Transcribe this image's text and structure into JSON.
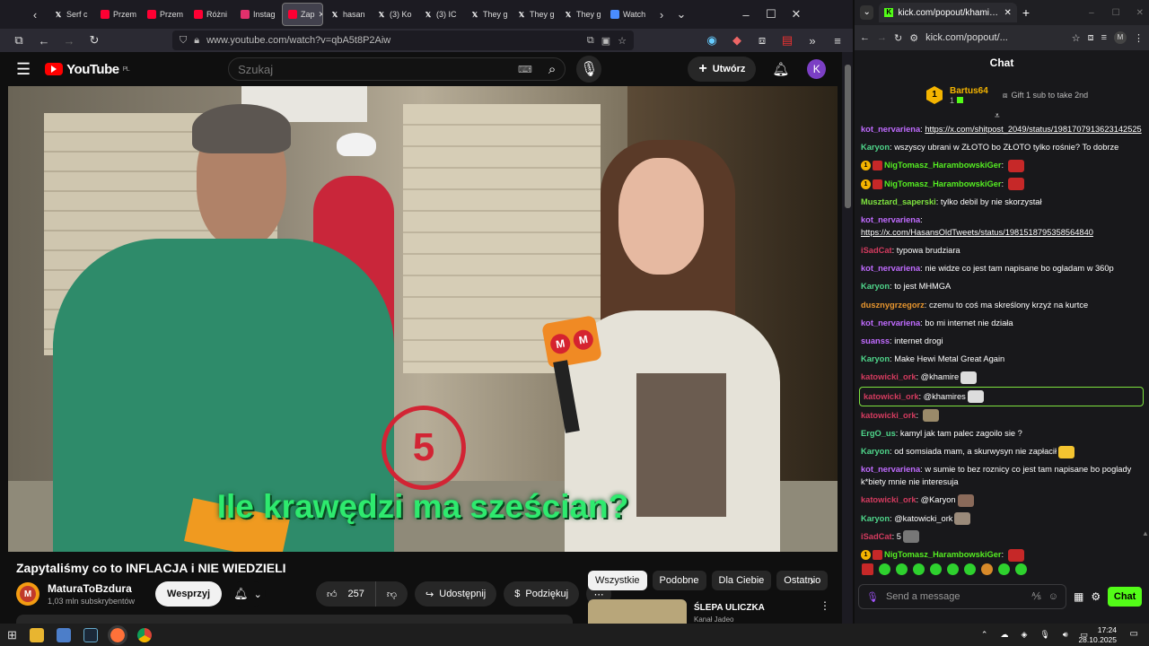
{
  "firefox": {
    "tabs": [
      {
        "label": "Serf c",
        "icon": "x-icon",
        "color": "#ffffff"
      },
      {
        "label": "Przem",
        "icon": "youtube-icon",
        "color": "#ff0033"
      },
      {
        "label": "Przem",
        "icon": "youtube-icon",
        "color": "#ff0033"
      },
      {
        "label": "Różni",
        "icon": "youtube-icon",
        "color": "#ff0033"
      },
      {
        "label": "Instag",
        "icon": "instagram-icon",
        "color": "#e1306c"
      },
      {
        "label": "Zap",
        "icon": "youtube-icon",
        "color": "#ff0033"
      },
      {
        "label": "hasan",
        "icon": "x-icon",
        "color": "#ffffff"
      },
      {
        "label": "(3) Ko",
        "icon": "x-icon",
        "color": "#ffffff"
      },
      {
        "label": "(3) IC",
        "icon": "x-icon",
        "color": "#ffffff"
      },
      {
        "label": "They g",
        "icon": "x-icon",
        "color": "#ffffff"
      },
      {
        "label": "They g",
        "icon": "x-icon",
        "color": "#ffffff"
      },
      {
        "label": "They g",
        "icon": "x-icon",
        "color": "#ffffff"
      },
      {
        "label": "Watch",
        "icon": "web-icon",
        "color": "#4a8cff"
      }
    ],
    "url": "www.youtube.com/watch?v=qbA5t8P2Aiw"
  },
  "youtube": {
    "logo": "YouTube",
    "region": "PL",
    "search_placeholder": "Szukaj",
    "create_label": "Utwórz",
    "avatar_letter": "K",
    "caption_text": "Ile krawędzi ma sześcian?",
    "overlay_number": "5",
    "video_title": "Zapytaliśmy co to INFLACJA i NIE WIEDZIELI",
    "channel_name": "MaturaToBzdura",
    "channel_initial": "M",
    "subscribers": "1,03 mln subskrybentów",
    "support_label": "Wesprzyj",
    "likes": "257",
    "share_label": "Udostępnij",
    "thanks_label": "Podziękuj",
    "chips": [
      "Wszystkie",
      "Podobne",
      "Dla Ciebie",
      "Ostatnio"
    ],
    "rec_title": "ŚLEPA ULICZKA",
    "rec_channel": "Kanał Jadeo"
  },
  "kick": {
    "tab_title": "kick.com/popout/khamires/cha",
    "url": "kick.com/popout/...",
    "chat_title": "Chat",
    "top_gifter": "Bartus64",
    "top_gifter_count": "1",
    "gift_label": "Gift 1 sub to take 2nd",
    "messages": [
      {
        "user": "kot_nervariena",
        "color": "#c06bff",
        "text": "",
        "link": "https://x.com/shitpost_2049/status/1981707913623142525"
      },
      {
        "user": "Karyon",
        "color": "#4fd68b",
        "text": "wszyscy ubrani w ZŁOTO bo ZŁOTO tylko rośnie? To dobrze"
      },
      {
        "user": "NigTomasz_HarambowskiGer",
        "color": "#55ee22",
        "text": "",
        "badge": "1",
        "emote": "#c62828"
      },
      {
        "user": "NigTomasz_HarambowskiGer",
        "color": "#55ee22",
        "text": "",
        "badge": "1",
        "emote": "#c62828"
      },
      {
        "user": "Musztard_saperski",
        "color": "#7ee33f",
        "text": "tylko debil by nie skorzystał"
      },
      {
        "user": "kot_nervariena",
        "color": "#c06bff",
        "text": "",
        "link": "https://x.com/HasansOldTweets/status/1981518795358564840",
        "wrap": true
      },
      {
        "user": "iSadCat",
        "color": "#d43b5f",
        "text": "typowa brudziara"
      },
      {
        "user": "kot_nervariena",
        "color": "#c06bff",
        "text": "nie widze co jest tam napisane bo ogladam w 360p"
      },
      {
        "user": "Karyon",
        "color": "#4fd68b",
        "text": "to jest MHMGA"
      },
      {
        "user": "dusznygrzegorz",
        "color": "#e8962e",
        "text": "czemu to coś ma skreślony krzyż na kurtce"
      },
      {
        "user": "kot_nervariena",
        "color": "#c06bff",
        "text": "bo mi internet nie działa"
      },
      {
        "user": "suanss",
        "color": "#c06bff",
        "text": "internet drogi"
      },
      {
        "user": "Karyon",
        "color": "#4fd68b",
        "text": "Make Hewi Metal Great Again"
      },
      {
        "user": "katowicki_ork",
        "color": "#d43b5f",
        "text": "@khamire",
        "emote": "#dddddd"
      },
      {
        "user": "katowicki_ork",
        "color": "#d43b5f",
        "text": "@khamires",
        "emote": "#dddddd",
        "highlight": true
      },
      {
        "user": "katowicki_ork",
        "color": "#d43b5f",
        "text": "",
        "emote": "#9a8a6a"
      },
      {
        "user": "ErgO_us",
        "color": "#4fd68b",
        "text": "kamyl jak tam palec zagoilo sie ?"
      },
      {
        "user": "Karyon",
        "color": "#4fd68b",
        "text": "od somsiada mam, a skurwysyn nie zapłacił",
        "emote": "#f4c430"
      },
      {
        "user": "kot_nervariena",
        "color": "#c06bff",
        "text": "w sumie to bez roznicy co jest tam napisane bo poglady k*biety mnie nie interesuja",
        "wrap": true
      },
      {
        "user": "katowicki_ork",
        "color": "#d43b5f",
        "text": "@Karyon",
        "emote": "#8a6a5a"
      },
      {
        "user": "Karyon",
        "color": "#4fd68b",
        "text": "@katowicki_ork",
        "emote": "#9a8a7a"
      },
      {
        "user": "iSadCat",
        "color": "#d43b5f",
        "text": "5",
        "emote": "#777777"
      },
      {
        "user": "NigTomasz_HarambowskiGer",
        "color": "#55ee22",
        "text": "",
        "badge": "1",
        "emote": "#c62828"
      }
    ],
    "input_placeholder": "Send a message",
    "send_label": "Chat"
  },
  "taskbar": {
    "time": "17:24",
    "date": "28.10.2025"
  }
}
